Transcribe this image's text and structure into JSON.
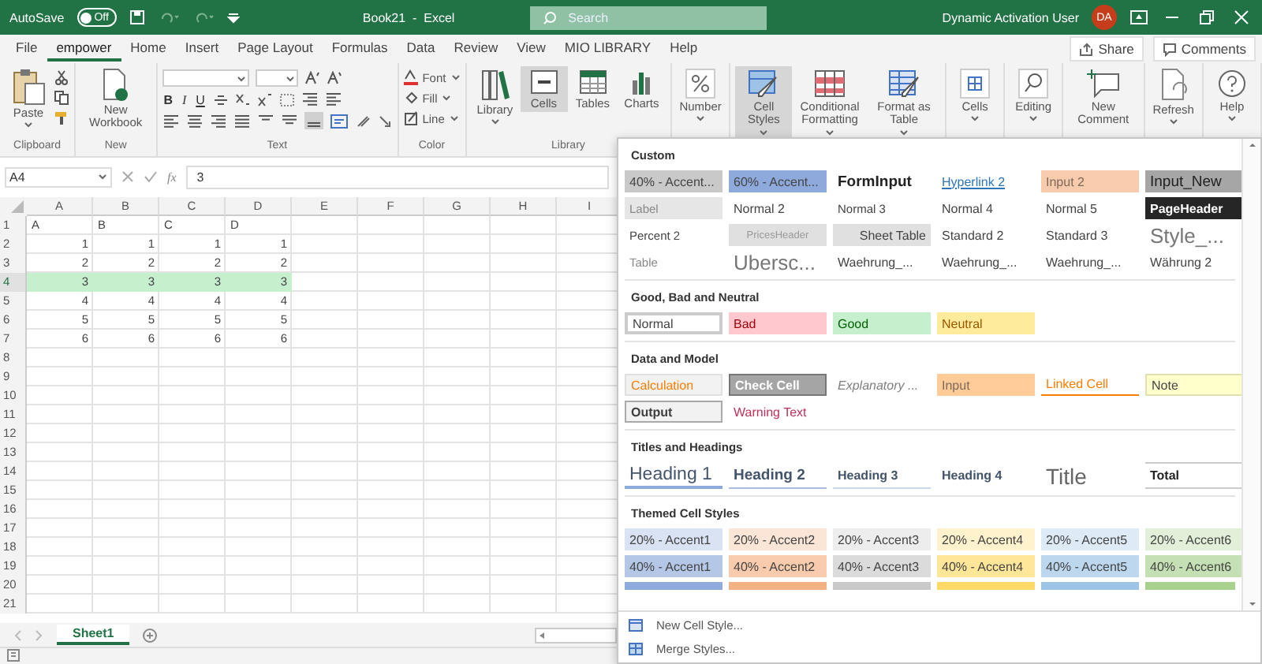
{
  "title_bar": {
    "autosave_label": "AutoSave",
    "autosave_toggle": {
      "label": "Off",
      "on": false
    },
    "title": "Book21  -  Excel",
    "search": {
      "placeholder": "Search"
    },
    "user": "Dynamic Activation User",
    "avatar": "DA"
  },
  "tabs": [
    {
      "label": "File",
      "selected": false
    },
    {
      "label": "empower",
      "selected": true
    },
    {
      "label": "Home",
      "selected": false
    },
    {
      "label": "Insert",
      "selected": false
    },
    {
      "label": "Page Layout",
      "selected": false
    },
    {
      "label": "Formulas",
      "selected": false
    },
    {
      "label": "Data",
      "selected": false
    },
    {
      "label": "Review",
      "selected": false
    },
    {
      "label": "View",
      "selected": false
    },
    {
      "label": "MIO LIBRARY",
      "selected": false
    },
    {
      "label": "Help",
      "selected": false
    }
  ],
  "share": "Share",
  "comments": "Comments",
  "ribbon": [
    {
      "kind": "big",
      "label": "Clipboard",
      "buttons": [
        {
          "label": "Paste",
          "selected": false,
          "dropdown": true
        }
      ]
    },
    {
      "kind": "big",
      "label": "New",
      "buttons": [
        {
          "label": "New Workbook",
          "selected": false,
          "dropdown": false
        }
      ]
    },
    {
      "kind": "text",
      "label": "Text",
      "format_buttons": [
        "B",
        "I",
        "U"
      ]
    },
    {
      "kind": "color",
      "label": "Color",
      "items": [
        "Font",
        "Fill",
        "Line"
      ]
    },
    {
      "kind": "big",
      "label": "Library",
      "buttons": [
        {
          "label": "Library",
          "selected": false,
          "dropdown": true
        },
        {
          "label": "Cells",
          "selected": true,
          "dropdown": false
        },
        {
          "label": "Tables",
          "selected": false,
          "dropdown": false
        },
        {
          "label": "Charts",
          "selected": false,
          "dropdown": false
        }
      ]
    },
    {
      "kind": "big",
      "buttons": [
        {
          "label": "Number",
          "selected": false,
          "dropdown": true
        }
      ]
    },
    {
      "kind": "big",
      "buttons": [
        {
          "label": "Cell Styles",
          "selected": true,
          "dropdown": true
        },
        {
          "label": "Conditional Formatting",
          "selected": false,
          "dropdown": true
        },
        {
          "label": "Format as Table",
          "selected": false,
          "dropdown": true
        }
      ]
    },
    {
      "kind": "big",
      "buttons": [
        {
          "label": "Cells",
          "selected": false,
          "dropdown": true
        }
      ]
    },
    {
      "kind": "big",
      "buttons": [
        {
          "label": "Editing",
          "selected": false,
          "dropdown": true
        }
      ]
    },
    {
      "kind": "big",
      "buttons": [
        {
          "label": "New Comment",
          "selected": false,
          "dropdown": false
        }
      ]
    },
    {
      "kind": "big",
      "buttons": [
        {
          "label": "Refresh",
          "selected": false,
          "dropdown": true
        }
      ]
    },
    {
      "kind": "big",
      "buttons": [
        {
          "label": "Help",
          "selected": false,
          "dropdown": true
        }
      ]
    }
  ],
  "formula_bar": {
    "name_box": "A4",
    "fx": "fx",
    "value": "3"
  },
  "sheet": {
    "columns": [
      "A",
      "B",
      "C",
      "D",
      "E",
      "F",
      "G",
      "H",
      "I"
    ],
    "rows": [
      {
        "header": "1",
        "kind": "labels",
        "selected": false,
        "cells": [
          "A",
          "B",
          "C",
          "D"
        ]
      },
      {
        "header": "2",
        "kind": "numbers",
        "selected": false,
        "cells": [
          "1",
          "1",
          "1",
          "1"
        ]
      },
      {
        "header": "3",
        "kind": "numbers",
        "selected": false,
        "cells": [
          "2",
          "2",
          "2",
          "2"
        ]
      },
      {
        "header": "4",
        "kind": "numbers",
        "selected": true,
        "cells": [
          "3",
          "3",
          "3",
          "3"
        ]
      },
      {
        "header": "5",
        "kind": "numbers",
        "selected": false,
        "cells": [
          "4",
          "4",
          "4",
          "4"
        ]
      },
      {
        "header": "6",
        "kind": "numbers",
        "selected": false,
        "cells": [
          "5",
          "5",
          "5",
          "5"
        ]
      },
      {
        "header": "7",
        "kind": "numbers",
        "selected": false,
        "cells": [
          "6",
          "6",
          "6",
          "6"
        ]
      },
      {
        "header": "8",
        "kind": "empty",
        "selected": false
      },
      {
        "header": "9",
        "kind": "empty",
        "selected": false
      },
      {
        "header": "10",
        "kind": "empty",
        "selected": false
      },
      {
        "header": "11",
        "kind": "empty",
        "selected": false
      },
      {
        "header": "12",
        "kind": "empty",
        "selected": false
      },
      {
        "header": "13",
        "kind": "empty",
        "selected": false
      },
      {
        "header": "14",
        "kind": "empty",
        "selected": false
      },
      {
        "header": "15",
        "kind": "empty",
        "selected": false
      },
      {
        "header": "16",
        "kind": "empty",
        "selected": false
      },
      {
        "header": "17",
        "kind": "empty",
        "selected": false
      },
      {
        "header": "18",
        "kind": "empty",
        "selected": false
      },
      {
        "header": "19",
        "kind": "empty",
        "selected": false
      },
      {
        "header": "20",
        "kind": "empty",
        "selected": false
      },
      {
        "header": "21",
        "kind": "empty",
        "selected": false
      }
    ],
    "sheet_tabs": [
      {
        "label": "Sheet1",
        "selected": true
      }
    ]
  },
  "gallery": {
    "sections": [
      {
        "title": "Custom",
        "styles": [
          {
            "label": "40% - Accent...",
            "kind": "plain",
            "color": "#c9c9c9"
          },
          {
            "label": "60% - Accent...",
            "kind": "plain",
            "color": "#8ea9db"
          },
          {
            "label": "FormInput",
            "kind": "bold"
          },
          {
            "label": "Hyperlink 2",
            "kind": "link"
          },
          {
            "label": "Input 2",
            "kind": "input",
            "color": "#f8cbad"
          },
          {
            "label": "Input_New",
            "kind": "big",
            "color": "#a6a6a6"
          },
          {
            "label": "Label",
            "kind": "faint",
            "color": "#e7e6e6"
          },
          {
            "label": "Normal 2",
            "kind": "plain"
          },
          {
            "label": "Normal 3",
            "kind": "small"
          },
          {
            "label": "Normal 4",
            "kind": "plain"
          },
          {
            "label": "Normal 5",
            "kind": "plain"
          },
          {
            "label": "PageHeader",
            "kind": "dark",
            "color": "#262626"
          },
          {
            "label": "Percent 2",
            "kind": "small"
          },
          {
            "label": "PricesHeader",
            "kind": "center",
            "color": "#e0e0e0"
          },
          {
            "label": "Sheet Table",
            "kind": "right",
            "color": "#e0e0e0"
          },
          {
            "label": "Standard 2",
            "kind": "plain"
          },
          {
            "label": "Standard 3",
            "kind": "plain"
          },
          {
            "label": "Style_...",
            "kind": "huge"
          },
          {
            "label": "Table",
            "kind": "faint"
          },
          {
            "label": "Ubersc...",
            "kind": "huge"
          },
          {
            "label": "Waehrung_...",
            "kind": "plain"
          },
          {
            "label": "Waehrung_...",
            "kind": "plain"
          },
          {
            "label": "Waehrung_...",
            "kind": "plain"
          },
          {
            "label": "Währung 2",
            "kind": "plain"
          }
        ]
      },
      {
        "title": "Good, Bad and Neutral",
        "styles": [
          {
            "label": "Normal",
            "kind": "boxed"
          },
          {
            "label": "Bad",
            "kind": "bad",
            "color": "#ffc7ce"
          },
          {
            "label": "Good",
            "kind": "good",
            "color": "#c6efce"
          },
          {
            "label": "Neutral",
            "kind": "neutral",
            "color": "#ffeb9c"
          }
        ]
      },
      {
        "title": "Data and Model",
        "styles": [
          {
            "label": "Calculation",
            "kind": "calc",
            "color": "#f2f2f2"
          },
          {
            "label": "Check Cell",
            "kind": "check",
            "color": "#a5a5a5"
          },
          {
            "label": "Explanatory ...",
            "kind": "italic"
          },
          {
            "label": "Input",
            "kind": "input",
            "color": "#ffcc99"
          },
          {
            "label": "Linked Cell",
            "kind": "linked"
          },
          {
            "label": "Note",
            "kind": "note",
            "color": "#ffffcc"
          },
          {
            "label": "Output",
            "kind": "output",
            "color": "#f2f2f2"
          },
          {
            "label": "Warning Text",
            "kind": "warning"
          }
        ]
      },
      {
        "title": "Titles and Headings",
        "styles": [
          {
            "label": "Heading 1",
            "kind": "heading1"
          },
          {
            "label": "Heading 2",
            "kind": "heading2"
          },
          {
            "label": "Heading 3",
            "kind": "heading3"
          },
          {
            "label": "Heading 4",
            "kind": "heading4"
          },
          {
            "label": "Title",
            "kind": "title"
          },
          {
            "label": "Total",
            "kind": "total"
          }
        ]
      },
      {
        "title": "Themed Cell Styles",
        "styles": [
          {
            "label": "20% - Accent1",
            "kind": "plain",
            "color": "#dae3f3"
          },
          {
            "label": "20% - Accent2",
            "kind": "plain",
            "color": "#fbe5d6"
          },
          {
            "label": "20% - Accent3",
            "kind": "plain",
            "color": "#ededed"
          },
          {
            "label": "20% - Accent4",
            "kind": "plain",
            "color": "#fff2cc"
          },
          {
            "label": "20% - Accent5",
            "kind": "plain",
            "color": "#deebf7"
          },
          {
            "label": "20% - Accent6",
            "kind": "plain",
            "color": "#e2f0d9"
          },
          {
            "label": "40% - Accent1",
            "kind": "plain",
            "color": "#b4c7e7"
          },
          {
            "label": "40% - Accent2",
            "kind": "plain",
            "color": "#f8cbad"
          },
          {
            "label": "40% - Accent3",
            "kind": "plain",
            "color": "#dbdbdb"
          },
          {
            "label": "40% - Accent4",
            "kind": "plain",
            "color": "#ffe699"
          },
          {
            "label": "40% - Accent5",
            "kind": "plain",
            "color": "#bdd7ee"
          },
          {
            "label": "40% - Accent6",
            "kind": "plain",
            "color": "#c5e0b4"
          }
        ],
        "partial_row": [
          {
            "color": "#8faadc"
          },
          {
            "color": "#f4b183"
          },
          {
            "color": "#c9c9c9"
          },
          {
            "color": "#ffd966"
          },
          {
            "color": "#9dc3e6"
          },
          {
            "color": "#a9d18e"
          }
        ]
      }
    ],
    "menu": [
      "New Cell Style...",
      "Merge Styles..."
    ]
  }
}
